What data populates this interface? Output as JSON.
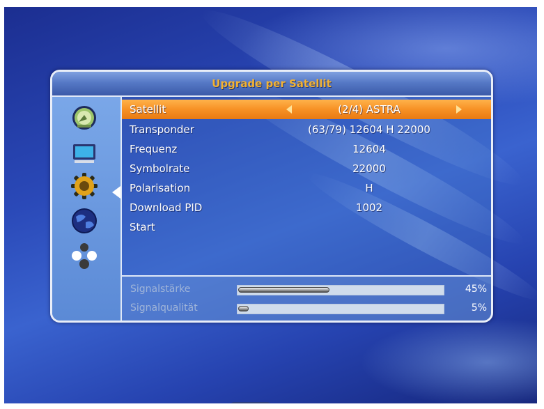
{
  "dialog": {
    "title": "Upgrade per Satellit"
  },
  "sidebar": {
    "icons": [
      "satellite-dish-icon",
      "tv-monitor-icon",
      "gear-icon",
      "globe-icon",
      "multimedia-balls-icon"
    ],
    "selected_index": 2
  },
  "settings": {
    "rows": [
      {
        "label": "Satellit",
        "value": "(2/4) ASTRA"
      },
      {
        "label": "Transponder",
        "value": "(63/79) 12604 H 22000"
      },
      {
        "label": "Frequenz",
        "value": "12604"
      },
      {
        "label": "Symbolrate",
        "value": "22000"
      },
      {
        "label": "Polarisation",
        "value": "H"
      },
      {
        "label": "Download PID",
        "value": "1002"
      },
      {
        "label": "Start",
        "value": ""
      }
    ],
    "selected_index": 0
  },
  "signal": {
    "strength_label": "Signalstärke",
    "strength_pct": "45%",
    "strength_value": 45,
    "quality_label": "Signalqualität",
    "quality_pct": "5%",
    "quality_value": 5
  },
  "colors": {
    "title": "#f2b233",
    "selected_row": "#f79125",
    "background": "#2a49b8"
  }
}
